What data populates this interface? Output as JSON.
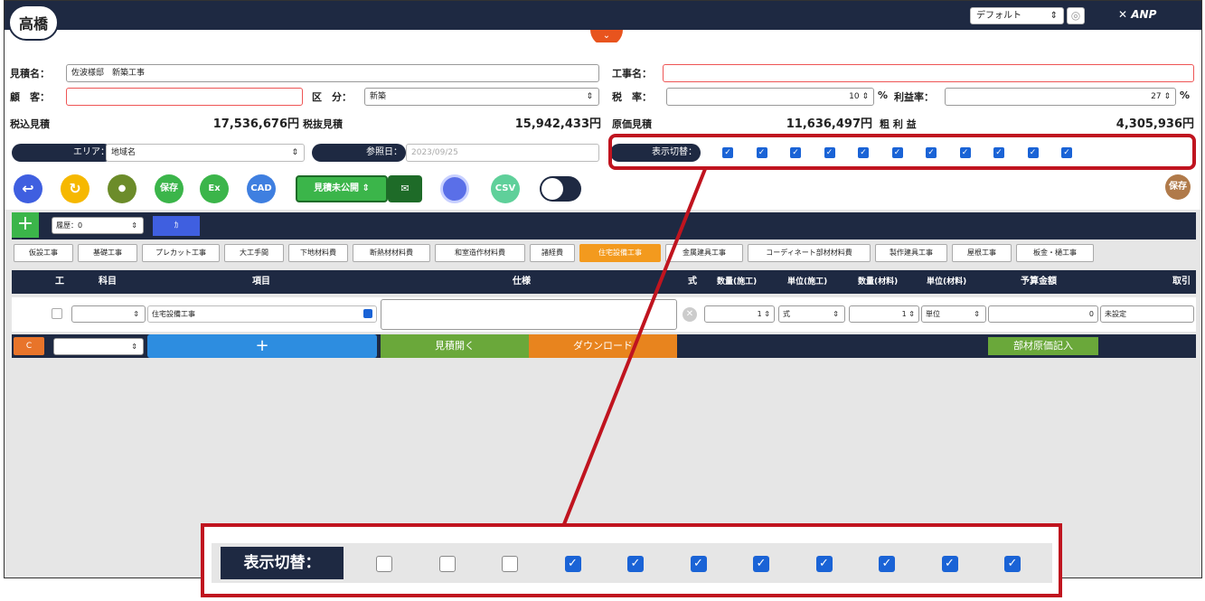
{
  "header": {
    "user_name": "高橋",
    "preset_value": "デフォルト",
    "logo_text": "ANP",
    "collapse_icon": "chevron-down-icon"
  },
  "form": {
    "estimate_label": "見積名：",
    "estimate_value": "佐波様邸　新築工事",
    "construction_label": "工事名：",
    "construction_value": "",
    "customer_label": "顧　客：",
    "customer_value": "",
    "category_label": "区　分：",
    "category_value": "新築",
    "tax_label": "税　率：",
    "tax_value": "10",
    "tax_unit": "%",
    "profit_rate_label": "利益率：",
    "profit_rate_value": "27",
    "profit_rate_unit": "%"
  },
  "summary": {
    "tax_incl_label": "税込見積",
    "tax_incl_value": "17,536,676円",
    "tax_excl_label": "税抜見積",
    "tax_excl_value": "15,942,433円",
    "cost_label": "原価見積",
    "cost_value": "11,636,497円",
    "gross_label": "粗 利 益",
    "gross_value": "4,305,936円"
  },
  "filters": {
    "area_label": "エリア：",
    "area_value": "地域名",
    "ref_date_label": "参照日：",
    "ref_date_value": "2023/09/25",
    "display_toggle_label": "表示切替："
  },
  "display_toggles": [
    true,
    true,
    true,
    true,
    true,
    true,
    true,
    true,
    true,
    true,
    true
  ],
  "zoom_toggles": [
    false,
    false,
    false,
    true,
    true,
    true,
    true,
    true,
    true,
    true,
    true
  ],
  "actions": {
    "save_label": "保存",
    "ex_label": "Ex",
    "cad_label": "CAD",
    "unpublished_label": "見積未公開",
    "csv_label": "CSV",
    "save_right_label": "保存"
  },
  "toolbar": {
    "history_value": "履歴：0",
    "small_btn_label": "ｶ"
  },
  "tabs": [
    "仮設工事",
    "基礎工事",
    "プレカット工事",
    "大工手間",
    "下地材料費",
    "断熱材材料費",
    "和室造作材料費",
    "諸経費",
    "住宅設備工事",
    "金属建具工事",
    "コーディネート部材材料費",
    "製作建具工事",
    "屋根工事",
    "板金・樋工事"
  ],
  "active_tab": "住宅設備工事",
  "table_header": {
    "ko": "工",
    "kamoku": "科目",
    "koumoku": "項目",
    "shiyou": "仕様",
    "shiki": "式",
    "qty_labor": "数量(施工)",
    "unit_labor": "単位(施工)",
    "qty_material": "数量(材料)",
    "unit_material": "単位(材料)",
    "budget": "予算金額",
    "deal": "取引"
  },
  "row": {
    "item": "住宅設備工事",
    "qty_labor": "1",
    "unit_labor": "式",
    "qty_material": "1",
    "unit_material": "単位",
    "budget": "0",
    "deal": "未設定"
  },
  "footer": {
    "c_label": "C",
    "add_icon": "plus-icon",
    "open_label": "見積開く",
    "download_label": "ダウンロード",
    "material_label": "部材原価記入"
  },
  "zoom": {
    "label": "表示切替："
  }
}
